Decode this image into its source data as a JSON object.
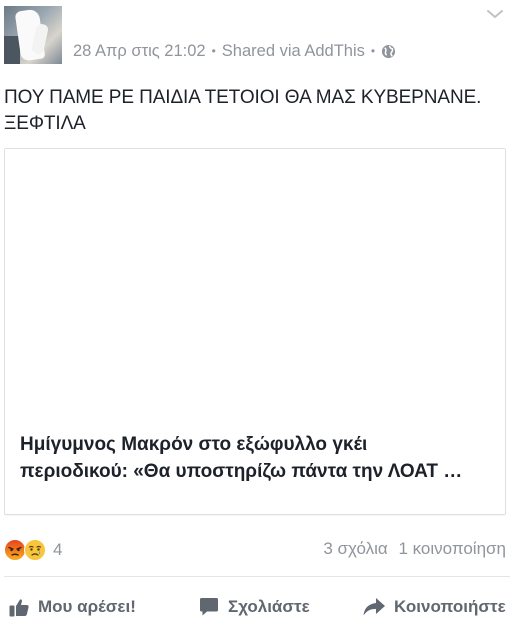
{
  "post": {
    "timestamp": "28 Απρ στις 21:02",
    "separator": "•",
    "shared_via": "Shared via AddThis",
    "privacy_icon": "globe-icon",
    "menu_icon": "chevron-down-icon",
    "text_line1": "ΠΟΥ ΠΑΜΕ ΡΕ ΠΑΙΔΙΑ ΤΕΤΟΙΟΙ ΘΑ ΜΑΣ ΚΥΒΕΡΝΑΝΕ.",
    "text_line2": "ΞΕΦΤΙΛΑ"
  },
  "link_card": {
    "title_line1": "Ημίγυμνος Μακρόν στο εξώφυλλο γκέι",
    "title_line2": "περιοδικού: «Θα υποστηρίζω πάντα την ΛΟΑΤ …"
  },
  "engagement": {
    "reactions": [
      "angry",
      "sad"
    ],
    "reaction_count": "4",
    "comments": "3 σχόλια",
    "shares": "1 κοινοποίηση"
  },
  "actions": {
    "like": "Μου αρέσει!",
    "comment": "Σχολιάστε",
    "share": "Κοινοποιήστε"
  },
  "colors": {
    "text": "#1d2129",
    "meta": "#90949c",
    "action": "#606770",
    "angry": "#e9710f",
    "sad": "#f7b125"
  }
}
